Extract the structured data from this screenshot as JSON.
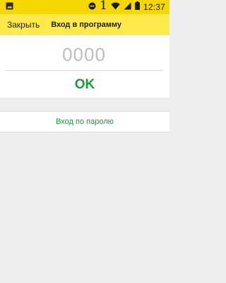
{
  "status_bar": {
    "time": "12:37",
    "indicator": "1",
    "icons": [
      "image-icon",
      "do-not-disturb-icon",
      "wifi-icon",
      "cell-signal-icon",
      "battery-icon"
    ]
  },
  "app_bar": {
    "close_label": "Закрыть",
    "title": "Вход в программу"
  },
  "pin": {
    "placeholder": "0000",
    "value": ""
  },
  "ok_label": "OK",
  "password_login_label": "Вход по паролю",
  "colors": {
    "status_bar": "#f5d800",
    "app_bar": "#fde94a",
    "accent_green": "#1c9a3e",
    "background": "#ededed"
  }
}
